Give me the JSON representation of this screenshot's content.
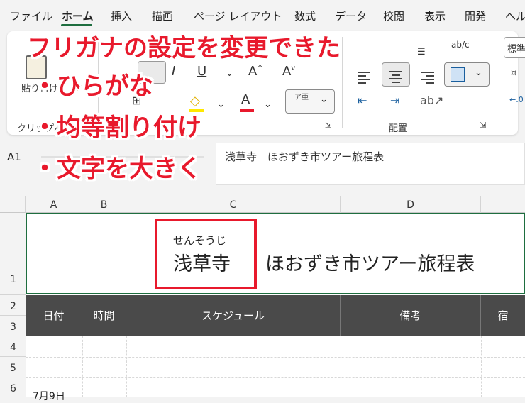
{
  "menu": {
    "items": [
      "ファイル",
      "ホーム",
      "挿入",
      "描画",
      "ページ レイアウト",
      "数式",
      "データ",
      "校閲",
      "表示",
      "開発",
      "ヘルプ"
    ],
    "active_index": 1
  },
  "ribbon": {
    "paste_label": "貼り付け",
    "clipboard_label": "クリップボード",
    "alignment_label": "配置",
    "number_format": "標準",
    "phonetic_button": "ア亜",
    "wrap_text_icon": "ab/c"
  },
  "formula_bar": {
    "cell_ref": "A1",
    "content": "浅草寺　ほおずき市ツアー旅程表"
  },
  "columns": [
    "A",
    "B",
    "C",
    "D"
  ],
  "rows": [
    "1",
    "2",
    "3",
    "4",
    "5",
    "6"
  ],
  "sheet": {
    "furigana": "せんそうじ",
    "title_main": "浅草寺",
    "title_rest": "ほおずき市ツアー旅程表",
    "headers": [
      "日付",
      "時間",
      "スケジュール",
      "備考",
      "宿"
    ],
    "a6_partial": "7月9日"
  },
  "annotations": {
    "title": "フリガナの設定を変更できた",
    "bullet1": "・ひらがな",
    "bullet2": "・均等割り付け",
    "bullet3": "・文字を大きく"
  },
  "colors": {
    "accent_green": "#1e6e3f",
    "highlight_red": "#e8192c",
    "header_dark": "#4a4a4a"
  }
}
